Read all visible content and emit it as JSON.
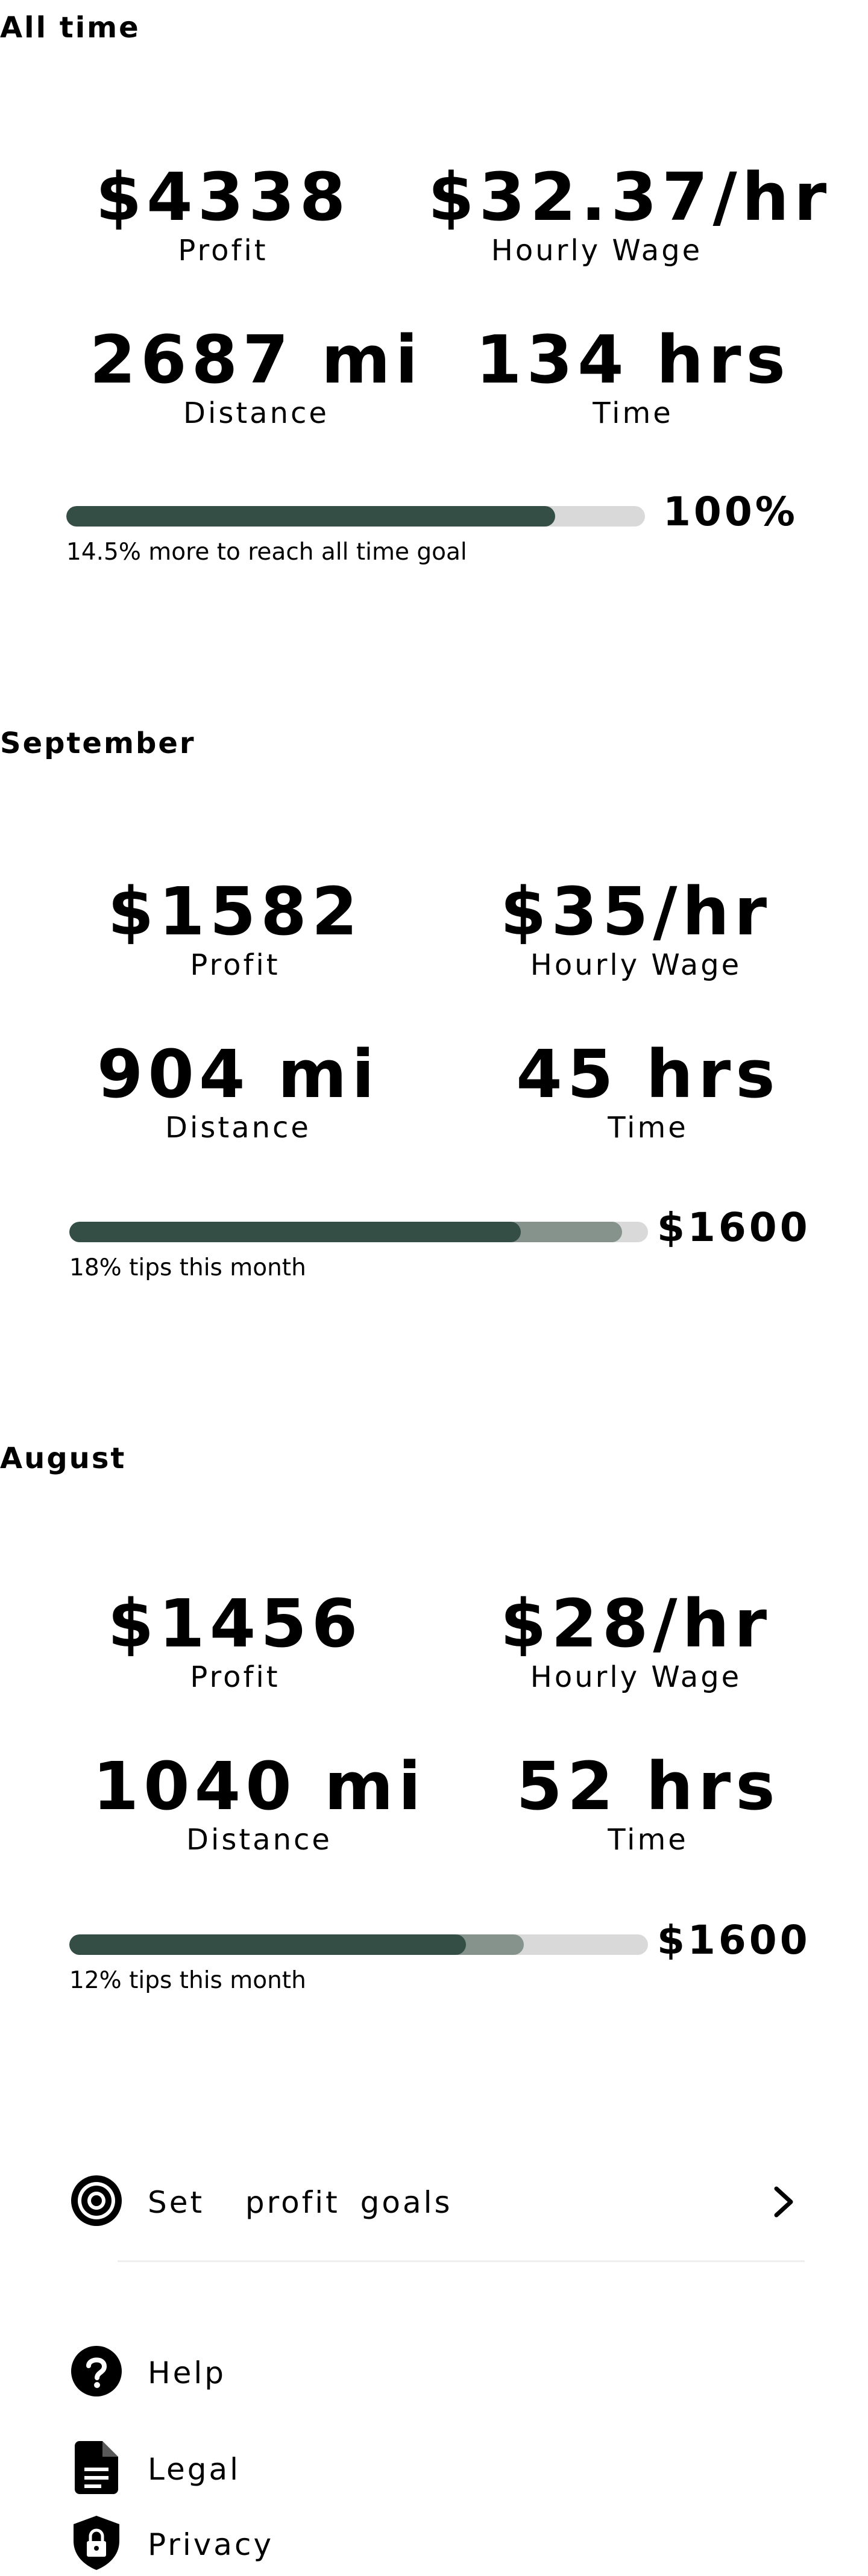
{
  "sections": [
    {
      "title": "All time",
      "stats": {
        "profit": {
          "value": "$4338",
          "label": "Profit"
        },
        "hourly_wage": {
          "value": "$32.37/hr",
          "label": "Hourly Wage"
        },
        "distance": {
          "value": "2687 mi",
          "label": "Distance"
        },
        "time": {
          "value": "134 hrs",
          "label": "Time"
        }
      },
      "progress": {
        "primary_fraction": 0.845,
        "secondary_fraction": 0.0,
        "value_text": "100%",
        "caption": "14.5% more to reach all time goal"
      }
    },
    {
      "title": "September",
      "stats": {
        "profit": {
          "value": "$1582",
          "label": "Profit"
        },
        "hourly_wage": {
          "value": "$35/hr",
          "label": "Hourly Wage"
        },
        "distance": {
          "value": "904 mi",
          "label": "Distance"
        },
        "time": {
          "value": "45 hrs",
          "label": "Time"
        }
      },
      "progress": {
        "primary_fraction": 0.78,
        "secondary_fraction": 0.955,
        "value_text": "$1600",
        "caption": "18% tips this month"
      }
    },
    {
      "title": "August",
      "stats": {
        "profit": {
          "value": "$1456",
          "label": "Profit"
        },
        "hourly_wage": {
          "value": "$28/hr",
          "label": "Hourly Wage"
        },
        "distance": {
          "value": "1040 mi",
          "label": "Distance"
        },
        "time": {
          "value": "52 hrs",
          "label": "Time"
        }
      },
      "progress": {
        "primary_fraction": 0.685,
        "secondary_fraction": 0.785,
        "value_text": "$1600",
        "caption": "12% tips this month"
      }
    }
  ],
  "menu": {
    "goals_label": "Set  profit goals",
    "help_label": "Help",
    "legal_label": "Legal",
    "privacy_label": "Privacy"
  },
  "colors": {
    "bar_primary": "#344e45",
    "bar_secondary": "#86938d",
    "bar_track": "#d9d9d9"
  },
  "icons": {
    "goals": "target-icon",
    "goals_arrow": "chevron-right-icon",
    "help": "help-circle-icon",
    "legal": "document-icon",
    "privacy": "shield-lock-icon"
  }
}
